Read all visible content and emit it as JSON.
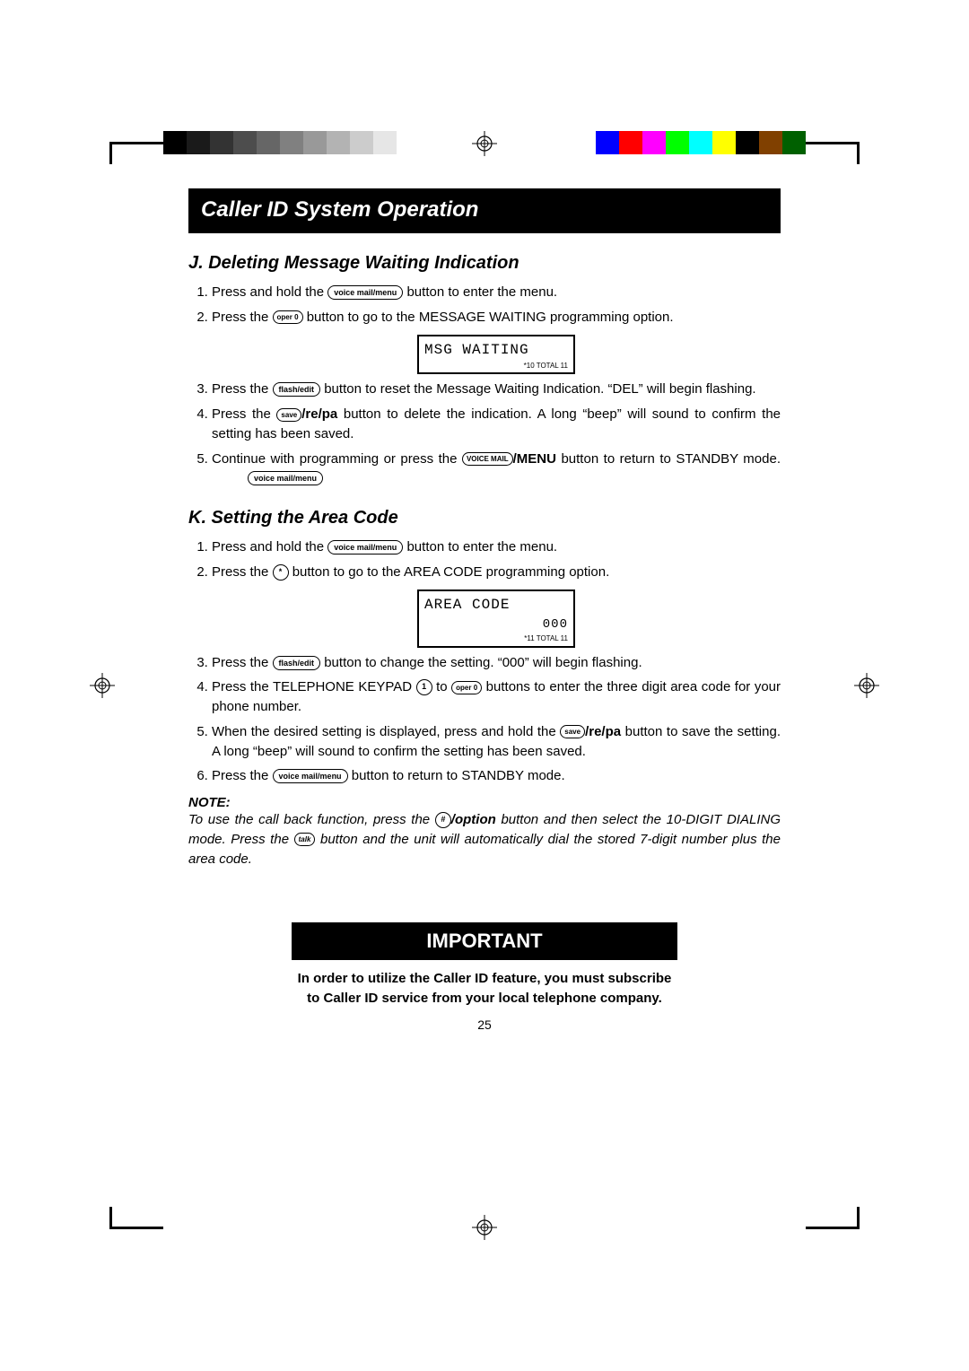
{
  "header_title": "Caller ID System Operation",
  "section_j": {
    "heading": "J. Deleting Message Waiting Indication",
    "step1_a": "Press and hold the ",
    "step1_btn": "voice mail/menu",
    "step1_b": " button to enter the menu.",
    "step2_a": "Press the ",
    "step2_btn": "oper 0",
    "step2_b": " button to go to the MESSAGE WAITING programming option.",
    "lcd_line1": "MSG WAITING",
    "lcd_foot": "*10 TOTAL 11",
    "step3_a": "Press the ",
    "step3_btn": "flash/edit",
    "step3_b": " button to reset the Message Waiting Indication. “DEL” will begin flashing.",
    "step4_a": "Press the ",
    "step4_btn": "save",
    "step4_aux": "/re/pa",
    "step4_b": " button to delete the indication. A long “beep” will sound to confirm the setting has been saved.",
    "step5_a": "Continue with programming or press the ",
    "step5_btn1": "VOICE MAIL",
    "step5_aux": "/MENU",
    "step5_b": " button to return to STANDBY mode.",
    "step5_btn2": "voice mail/menu"
  },
  "section_k": {
    "heading": "K. Setting the Area Code",
    "step1_a": "Press and hold the ",
    "step1_btn": "voice mail/menu",
    "step1_b": " button to enter the menu.",
    "step2_a": "Press the ",
    "step2_btn": "*",
    "step2_b": " button to go to the AREA CODE programming option.",
    "lcd_line1": "AREA CODE",
    "lcd_line2": "000",
    "lcd_foot": "*11 TOTAL 11",
    "step3_a": "Press the ",
    "step3_btn": "flash/edit",
    "step3_b": " button to change the setting. “000” will begin flashing.",
    "step4_a": "Press the TELEPHONE KEYPAD ",
    "step4_btn1": "1",
    "step4_mid": " to ",
    "step4_btn2": "oper 0",
    "step4_b": " buttons to enter the three digit area code for your phone number.",
    "step5_a": "When the desired setting is displayed, press and hold the ",
    "step5_btn": "save",
    "step5_aux": "/re/pa",
    "step5_b": " button to save the setting. A long “beep” will sound to confirm the setting has been saved.",
    "step6_a": "Press the ",
    "step6_btn": "voice mail/menu",
    "step6_b": " button to return to STANDBY mode."
  },
  "note": {
    "heading": "NOTE:",
    "a": "To use the call back function, press the ",
    "btn1": "#",
    "aux1": "/option",
    "b": " button and then select the 10-DIGIT DIALING mode. Press the ",
    "btn2": "talk",
    "c": " button and the unit will automatically dial the stored 7-digit number plus the area code."
  },
  "important": {
    "title": "IMPORTANT",
    "body": "In order to utilize the Caller ID feature, you must subscribe to Caller ID service from your local telephone company."
  },
  "page_number": "25",
  "gray_steps": [
    "#000000",
    "#1a1a1a",
    "#333333",
    "#4d4d4d",
    "#666666",
    "#808080",
    "#999999",
    "#b3b3b3",
    "#cccccc",
    "#e6e6e6",
    "#ffffff"
  ],
  "color_steps": [
    "#ffffff",
    "#0000ff",
    "#ff0000",
    "#ff00ff",
    "#00ff00",
    "#00ffff",
    "#ffff00",
    "#000000",
    "#804000",
    "#006000"
  ]
}
